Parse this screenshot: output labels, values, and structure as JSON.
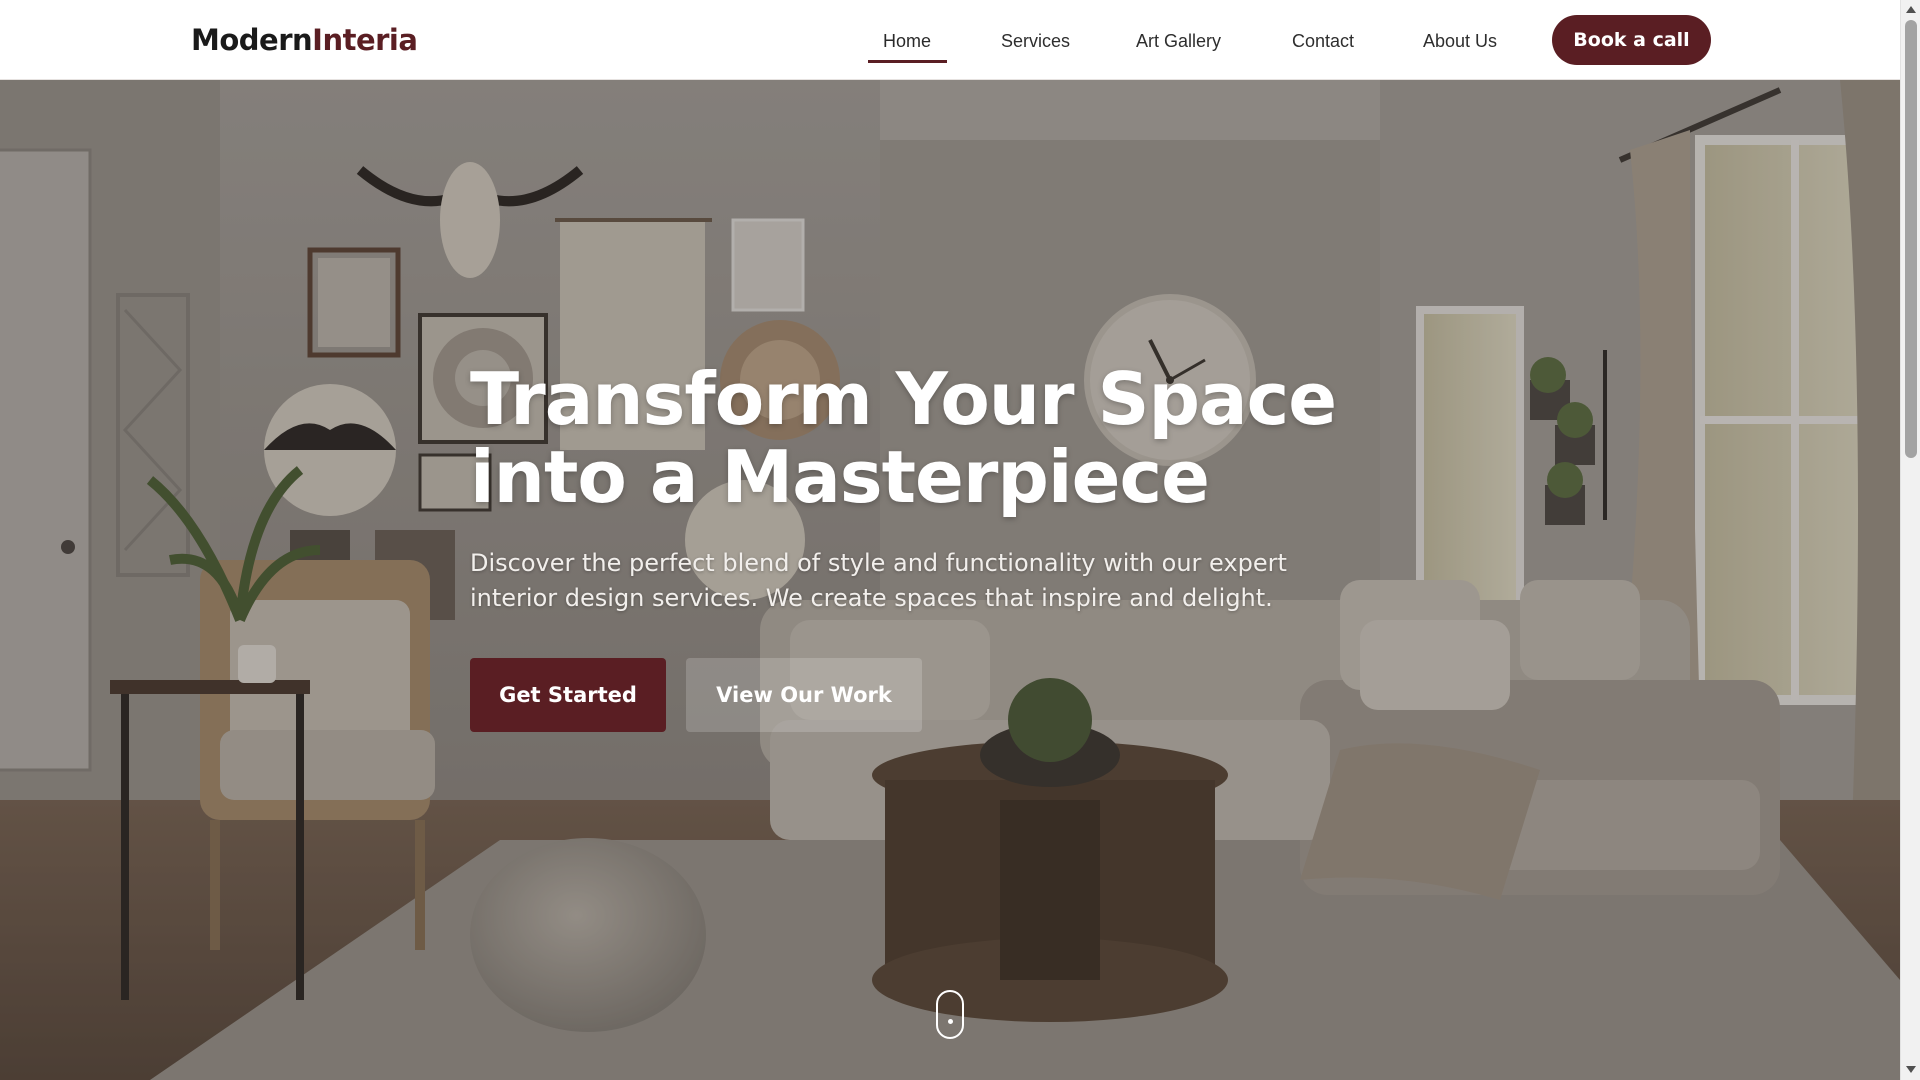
{
  "brand": {
    "part1": "Modern",
    "part2": "Interia"
  },
  "nav": {
    "items": [
      {
        "label": "Home",
        "active": true
      },
      {
        "label": "Services",
        "active": false
      },
      {
        "label": "Art Gallery",
        "active": false
      },
      {
        "label": "Contact",
        "active": false
      },
      {
        "label": "About Us",
        "active": false
      }
    ],
    "cta_label": "Book a call"
  },
  "hero": {
    "title": "Transform Your Space into a Masterpiece",
    "subtitle": "Discover the perfect blend of style and functionality with our expert interior design services. We create spaces that inspire and delight.",
    "primary_label": "Get Started",
    "secondary_label": "View Our Work",
    "background_icon": "living-room-photo",
    "scroll_icon": "mouse-scroll-icon"
  },
  "colors": {
    "brand_accent": "#5a1e23",
    "text_dark": "#1a1a1a",
    "hero_text": "#ffffff"
  }
}
